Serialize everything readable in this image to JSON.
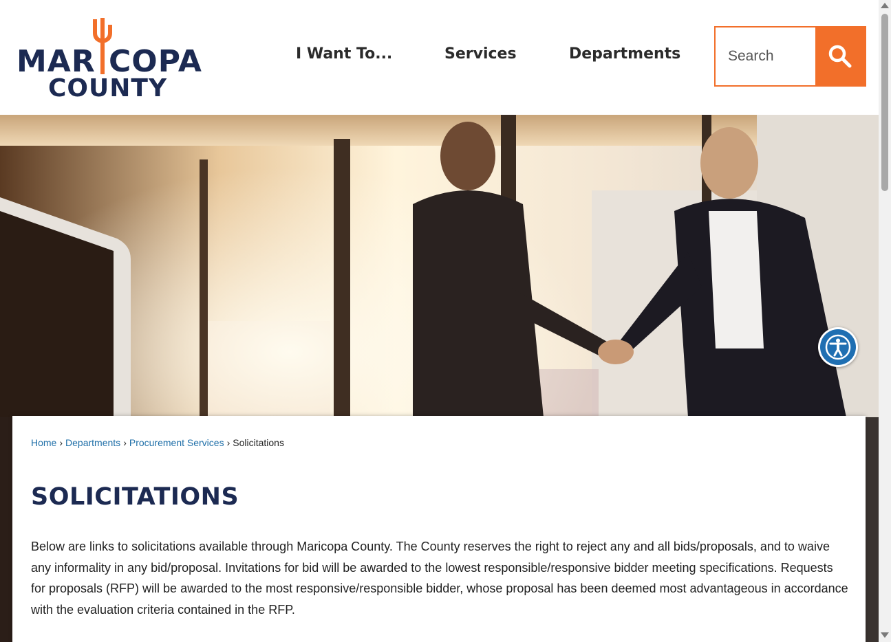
{
  "header": {
    "logo": {
      "line1_left": "MAR",
      "line1_right": "COPA",
      "line2": "COUNTY"
    },
    "nav": [
      {
        "label": "I Want To..."
      },
      {
        "label": "Services"
      },
      {
        "label": "Departments"
      }
    ],
    "search": {
      "placeholder": "Search"
    }
  },
  "breadcrumb": {
    "items": [
      {
        "label": "Home"
      },
      {
        "label": "Departments"
      },
      {
        "label": "Procurement Services"
      },
      {
        "label": "Solicitations"
      }
    ],
    "separator": "›"
  },
  "content": {
    "title": "SOLICITATIONS",
    "intro": "Below are links to solicitations available through Maricopa County. The County reserves the right to reject any and all bids/proposals, and to waive any informality in any bid/proposal. Invitations for bid will be awarded to the lowest responsible/responsive bidder meeting specifications. Requests for proposals (RFP) will be awarded to the most responsive/responsible bidder, whose proposal has been deemed most advantageous in accordance with the evaluation criteria contained in the RFP."
  },
  "colors": {
    "brand_navy": "#1c2a52",
    "brand_orange": "#f26f2a",
    "link_blue": "#1f6fa8",
    "accessibility_blue": "#1f6fb2"
  },
  "icons": {
    "search": "search-icon",
    "accessibility": "accessibility-icon",
    "logo_mark": "cactus-icon"
  }
}
